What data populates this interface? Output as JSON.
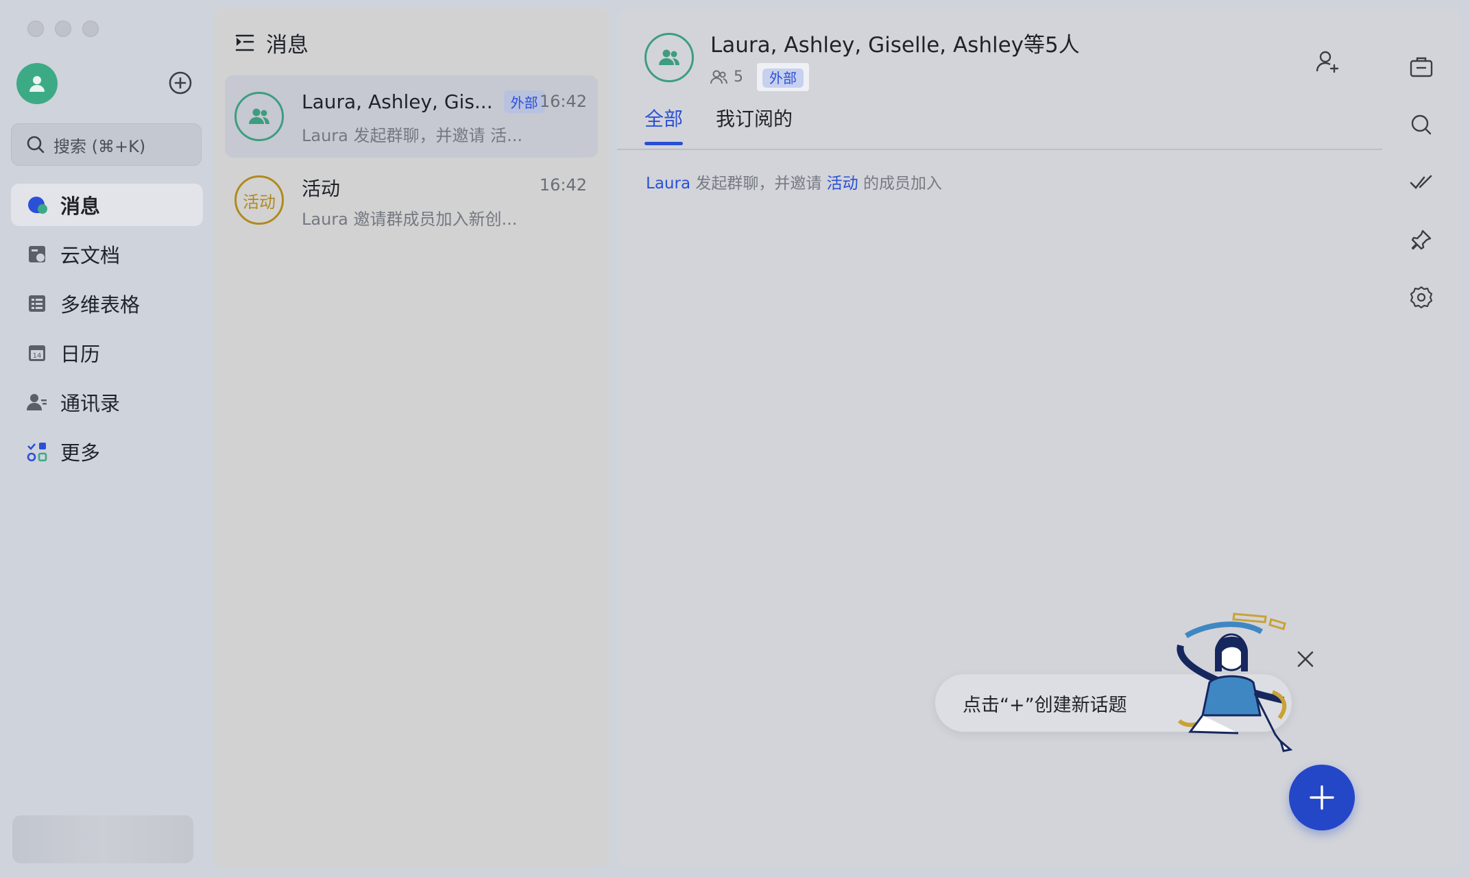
{
  "sidebar": {
    "search_placeholder": "搜索 (⌘+K)",
    "nav": [
      {
        "label": "消息",
        "icon": "message-icon",
        "active": true
      },
      {
        "label": "云文档",
        "icon": "docs-icon",
        "active": false
      },
      {
        "label": "多维表格",
        "icon": "base-icon",
        "active": false
      },
      {
        "label": "日历",
        "icon": "calendar-icon",
        "active": false,
        "icon_text": "14"
      },
      {
        "label": "通讯录",
        "icon": "contacts-icon",
        "active": false
      },
      {
        "label": "更多",
        "icon": "more-apps-icon",
        "active": false
      }
    ]
  },
  "conversations": {
    "header": "消息",
    "items": [
      {
        "title": "Laura, Ashley, Gis...",
        "badge": "外部",
        "time": "16:42",
        "preview": "Laura 发起群聊，并邀请 活...",
        "selected": true
      },
      {
        "title": "活动",
        "avatar_text": "活动",
        "time": "16:42",
        "preview": "Laura 邀请群成员加入新创...",
        "selected": false
      }
    ]
  },
  "chat": {
    "title": "Laura, Ashley, Giselle, Ashley等5人",
    "member_count": "5",
    "badge": "外部",
    "tabs": [
      {
        "label": "全部",
        "active": true
      },
      {
        "label": "我订阅的",
        "active": false
      }
    ],
    "system_message": {
      "actor": "Laura",
      "text1": "发起群聊，并邀请",
      "target": "活动",
      "text2": "的成员加入"
    },
    "tooltip": "点击“+”创建新话题"
  },
  "colors": {
    "accent": "#2a4fd6",
    "fab": "#2447c8",
    "avatar_green": "#3daa86",
    "activity_gold": "#b08a1e"
  }
}
